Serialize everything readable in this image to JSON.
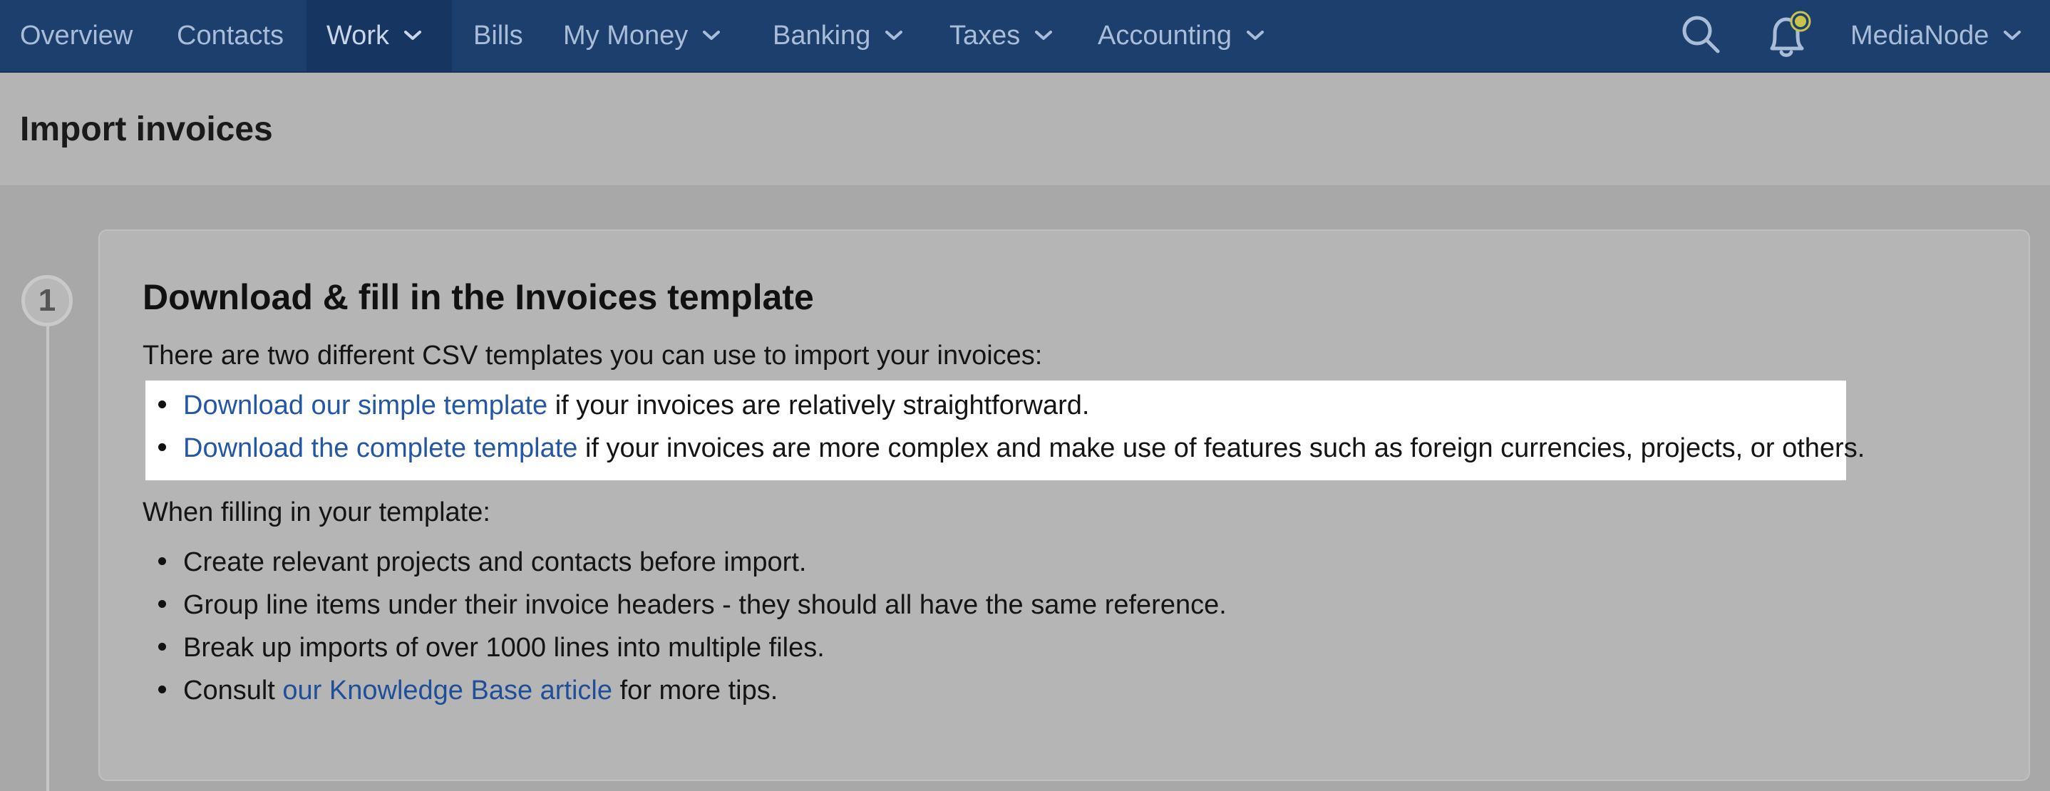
{
  "nav": {
    "items": [
      {
        "label": "Overview",
        "dropdown": false
      },
      {
        "label": "Contacts",
        "dropdown": false
      },
      {
        "label": "Work",
        "dropdown": true,
        "active": true
      },
      {
        "label": "Bills",
        "dropdown": false
      },
      {
        "label": "My Money",
        "dropdown": true
      },
      {
        "label": "Banking",
        "dropdown": true
      },
      {
        "label": "Taxes",
        "dropdown": true
      },
      {
        "label": "Accounting",
        "dropdown": true
      }
    ],
    "search_icon": "search-icon",
    "notifications_icon": "bell-icon",
    "account_label": "MediaNode"
  },
  "page": {
    "title": "Import invoices"
  },
  "step": {
    "number": "1",
    "title": "Download & fill in the Invoices template",
    "intro": "There are two different CSV templates you can use to import your invoices:",
    "templates": [
      {
        "link": "Download our simple template",
        "rest": " if your invoices are relatively straightforward."
      },
      {
        "link": "Download the complete template",
        "rest": " if your invoices are more complex and make use of features such as foreign currencies, projects, or others."
      }
    ],
    "filling_intro": "When filling in your template:",
    "tips": [
      "Create relevant projects and contacts before import.",
      "Group line items under their invoice headers - they should all have the same reference.",
      "Break up imports of over 1000 lines into multiple files."
    ],
    "kb": {
      "prefix": "Consult ",
      "link": "our Knowledge Base article",
      "suffix": " for more tips."
    }
  },
  "colors": {
    "nav_bg": "#1c3f6e",
    "link": "#2456a6",
    "notification_dot": "#c8c44a"
  }
}
